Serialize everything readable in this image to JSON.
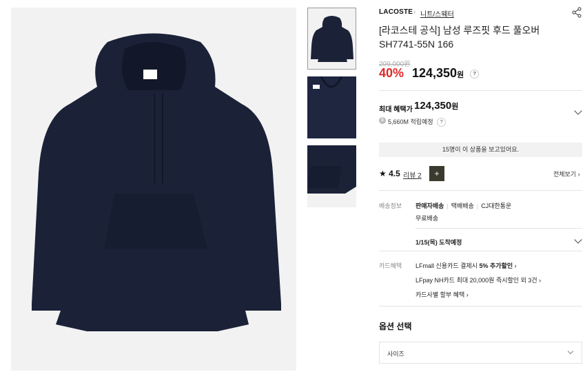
{
  "product": {
    "brand": "LACOSTE",
    "breadcrumb_sep": "›",
    "category": "니트/스웨터",
    "title": "[라코스테 공식] 남성 루즈핏 후드 풀오버 SH7741-55N 166",
    "original_price": "209,000원",
    "discount": "40%",
    "price_number": "124,350",
    "price_unit": "원",
    "help_mark": "?"
  },
  "benefit": {
    "label": "최대 혜택가",
    "price_number": "124,350",
    "price_unit": "원",
    "coin_symbol": "$",
    "points": "5,660M 적립예정",
    "help_mark": "?"
  },
  "viewers": "15명이 이 상품을 보고있어요.",
  "reviews": {
    "star": "★",
    "rating": "4.5",
    "review_label": "리뷰 2",
    "thumb_plus": "+",
    "view_all": "전체보기 ›"
  },
  "shipping": {
    "label": "배송정보",
    "tags": [
      "판매자배송",
      "택배배송",
      "CJ대한통운"
    ],
    "tag_sep": "|",
    "free": "무료배송",
    "arrival": "1/15(목) 도착예정"
  },
  "card": {
    "label": "카드혜택",
    "line1_prefix": "LFmall 신용카드 결제시 ",
    "line1_bold": "5% 추가할인",
    "line1_arrow": "›",
    "line2": "LFpay NH카드 최대 20,000원 즉시할인 외 3건 ›",
    "line3": "카드사별 할부 혜택 ›"
  },
  "options": {
    "heading": "옵션 선택",
    "size_placeholder": "사이즈"
  },
  "colors": {
    "hoodie": "#1b2238",
    "discount": "#e0282a"
  }
}
